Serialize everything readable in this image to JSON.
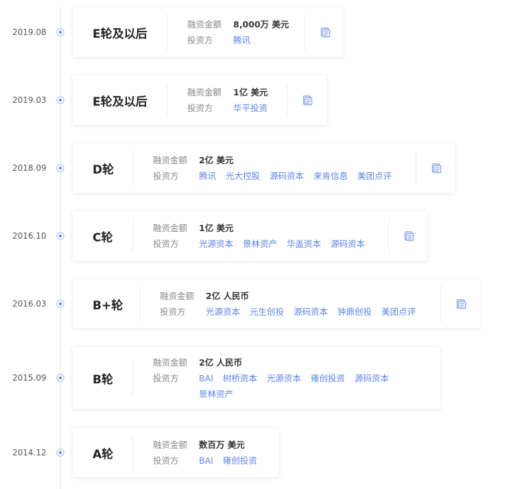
{
  "amount_label": "融资金额",
  "investor_label": "投资方",
  "colors": {
    "accent": "#5b84e8",
    "line": "#eef0f5",
    "dot_ring": "#c9d6f5"
  },
  "events": [
    {
      "date": "2019.08",
      "round": "E轮及以后",
      "amount": "8,000万 美元",
      "investors": [
        "腾讯"
      ],
      "icon": "document-icon"
    },
    {
      "date": "2019.03",
      "round": "E轮及以后",
      "amount": "1亿 美元",
      "investors": [
        "华平投资"
      ],
      "icon": "document-icon"
    },
    {
      "date": "2018.09",
      "round": "D轮",
      "amount": "2亿 美元",
      "investors": [
        "腾讯",
        "光大控股",
        "源码资本",
        "来肯信息",
        "美团点评"
      ],
      "icon": "document-icon"
    },
    {
      "date": "2016.10",
      "round": "C轮",
      "amount": "1亿 美元",
      "investors": [
        "光源资本",
        "景林资产",
        "华盖资本",
        "源码资本"
      ],
      "icon": "document-icon"
    },
    {
      "date": "2016.03",
      "round": "B+轮",
      "amount": "2亿 人民币",
      "investors": [
        "光源资本",
        "元生创投",
        "源码资本",
        "钟鼎创投",
        "美团点评"
      ],
      "icon": "document-icon"
    },
    {
      "date": "2015.09",
      "round": "B轮",
      "amount": "2亿 人民币",
      "investors": [
        "BAI",
        "树桥资本",
        "光源资本",
        "雍创投资",
        "源码资本",
        "景林资产"
      ]
    },
    {
      "date": "2014.12",
      "round": "A轮",
      "amount": "数百万 美元",
      "investors": [
        "BAI",
        "雍创投资"
      ]
    }
  ]
}
